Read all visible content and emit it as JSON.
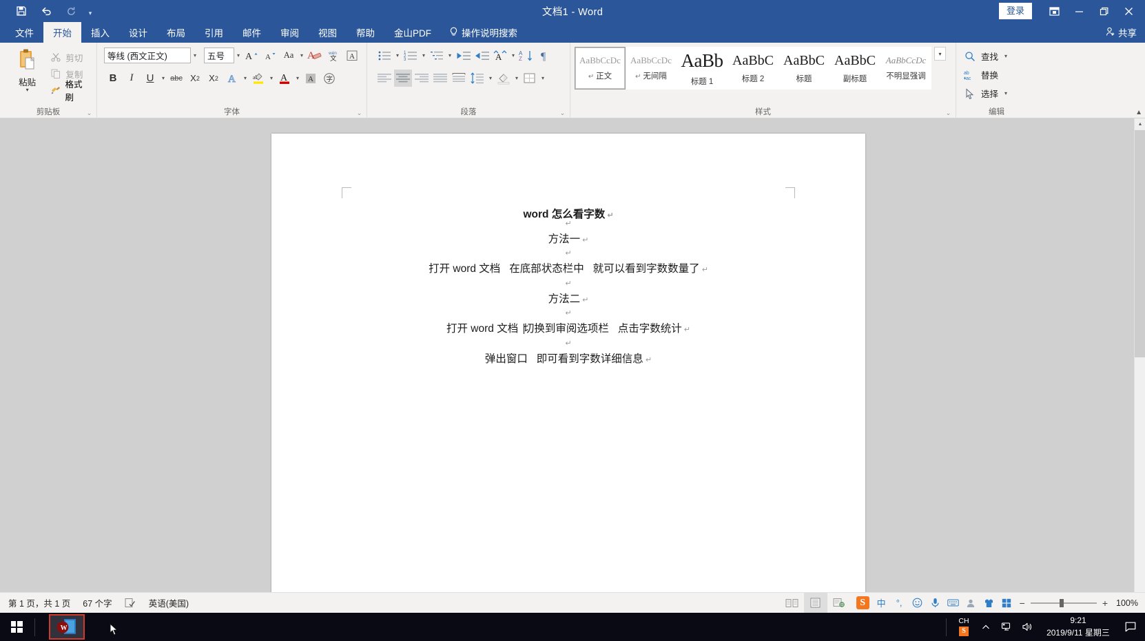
{
  "titlebar": {
    "title": "文档1  -  Word",
    "quick_access": [
      {
        "name": "save-icon",
        "label": "保存"
      },
      {
        "name": "undo-icon",
        "label": "撤消"
      },
      {
        "name": "redo-icon",
        "label": "恢复"
      }
    ],
    "customize_label": "自定义快速访问工具栏",
    "signin_label": "登录",
    "ribbon_display_label": "功能区显示选项",
    "minimize_label": "最小化",
    "restore_label": "还原",
    "close_label": "关闭"
  },
  "tabs": [
    {
      "label": "文件",
      "active": false
    },
    {
      "label": "开始",
      "active": true
    },
    {
      "label": "插入",
      "active": false
    },
    {
      "label": "设计",
      "active": false
    },
    {
      "label": "布局",
      "active": false
    },
    {
      "label": "引用",
      "active": false
    },
    {
      "label": "邮件",
      "active": false
    },
    {
      "label": "审阅",
      "active": false
    },
    {
      "label": "视图",
      "active": false
    },
    {
      "label": "帮助",
      "active": false
    },
    {
      "label": "金山PDF",
      "active": false
    }
  ],
  "tell_me": "操作说明搜索",
  "share_label": "共享",
  "ribbon": {
    "clipboard": {
      "label": "剪贴板",
      "paste": "粘贴",
      "cut": "剪切",
      "copy": "复制",
      "format_painter": "格式刷"
    },
    "font": {
      "label": "字体",
      "font_name": "等线 (西文正文)",
      "font_size": "五号",
      "grow_font": "增大字号",
      "shrink_font": "减小字号",
      "change_case": "Aa",
      "clear_formatting": "清除所有格式",
      "phonetic_guide": "拼音指南",
      "char_border": "字符边框",
      "bold": "B",
      "italic": "I",
      "underline": "U",
      "strikethrough": "abc",
      "subscript": "X₂",
      "superscript": "X²",
      "text_effects": "文本效果和版式",
      "highlight": "文本突出显示颜色",
      "font_color": "字体颜色",
      "char_shading": "字符底纹",
      "enclose_char": "带圈字符"
    },
    "paragraph": {
      "label": "段落",
      "bullets": "项目符号",
      "numbering": "编号",
      "multilevel": "多级列表",
      "decrease_indent": "减少缩进量",
      "increase_indent": "增加缩进量",
      "cn_layout": "中文版式",
      "sort": "排序",
      "show_marks": "显示/隐藏编辑标记",
      "align_left": "左对齐",
      "align_center": "居中",
      "align_right": "右对齐",
      "justify": "两端对齐",
      "distribute": "分散对齐",
      "line_spacing": "行和段落间距",
      "shading": "底纹",
      "borders": "边框"
    },
    "styles": {
      "label": "样式",
      "items": [
        {
          "preview": "AaBbCcDc",
          "name": "正文",
          "kind": "norm",
          "pilcrow": true,
          "selected": true
        },
        {
          "preview": "AaBbCcDc",
          "name": "无间隔",
          "kind": "norm",
          "pilcrow": true,
          "selected": false
        },
        {
          "preview": "AaBb",
          "name": "标题 1",
          "kind": "h1",
          "pilcrow": false,
          "selected": false
        },
        {
          "preview": "AaBbC",
          "name": "标题 2",
          "kind": "h2",
          "pilcrow": false,
          "selected": false
        },
        {
          "preview": "AaBbC",
          "name": "标题",
          "kind": "t",
          "pilcrow": false,
          "selected": false
        },
        {
          "preview": "AaBbC",
          "name": "副标题",
          "kind": "st",
          "pilcrow": false,
          "selected": false
        },
        {
          "preview": "AaBbCcDc",
          "name": "不明显强调",
          "kind": "em",
          "pilcrow": false,
          "selected": false
        }
      ],
      "more_label": "其他"
    },
    "editing": {
      "label": "编辑",
      "find": "查找",
      "replace": "替换",
      "select": "选择"
    }
  },
  "document": {
    "paragraphs": [
      {
        "text": "word 怎么看字数",
        "style": "title",
        "mark": "↵"
      },
      {
        "text": "",
        "style": "blank",
        "mark": "↵"
      },
      {
        "text": "方法一",
        "style": "body",
        "mark": "↵"
      },
      {
        "text": "",
        "style": "blank",
        "mark": "↵"
      },
      {
        "text": "打开 word 文档   在底部状态栏中   就可以看到字数数量了",
        "style": "body",
        "mark": "↵"
      },
      {
        "text": "",
        "style": "blank",
        "mark": "↵"
      },
      {
        "text": "方法二",
        "style": "body",
        "mark": "↵"
      },
      {
        "text": "",
        "style": "blank",
        "mark": "↵"
      },
      {
        "text": "打开 word 文档  ",
        "text2": "切换到审阅选项栏   点击字数统计",
        "style": "body",
        "cursor": true,
        "mark": "↵"
      },
      {
        "text": "",
        "style": "blank",
        "mark": "↵"
      },
      {
        "text": "弹出窗口   即可看到字数详细信息",
        "style": "body",
        "mark": "↵"
      }
    ]
  },
  "statusbar": {
    "page_info": "第 1 页，共 1 页",
    "word_count": "67 个字",
    "proofing_label": "校对",
    "language": "英语(美国)",
    "views": [
      {
        "name": "read-mode",
        "label": "阅读视图",
        "active": false
      },
      {
        "name": "print-layout",
        "label": "页面视图",
        "active": true
      },
      {
        "name": "web-layout",
        "label": "Web 版式视图",
        "active": false
      }
    ],
    "ime": {
      "name": "搜狗拼音输入法",
      "mode": "中",
      "items": [
        "中",
        "°,",
        "☺",
        "🎤",
        "⌨",
        "👤",
        "👕",
        "⊞"
      ]
    },
    "zoom_percent": "100%"
  },
  "taskbar": {
    "start_label": "开始",
    "apps": [
      {
        "name": "word-taskbar-item",
        "label": "Word"
      }
    ],
    "tray_ime_label": "CH",
    "tray": [
      {
        "name": "show-hidden-icons",
        "label": "显示隐藏的图标"
      },
      {
        "name": "network-icon",
        "label": "网络"
      },
      {
        "name": "volume-icon",
        "label": "音量"
      }
    ],
    "clock_time": "9:21",
    "clock_date": "2019/9/11 星期三",
    "action_center_label": "操作中心"
  },
  "colors": {
    "word_blue": "#2b579a",
    "ribbon_bg": "#f3f2f1",
    "doc_bg": "#d0d0d0",
    "accent_red": "#d13b2e",
    "sogou_orange": "#f4761f"
  }
}
